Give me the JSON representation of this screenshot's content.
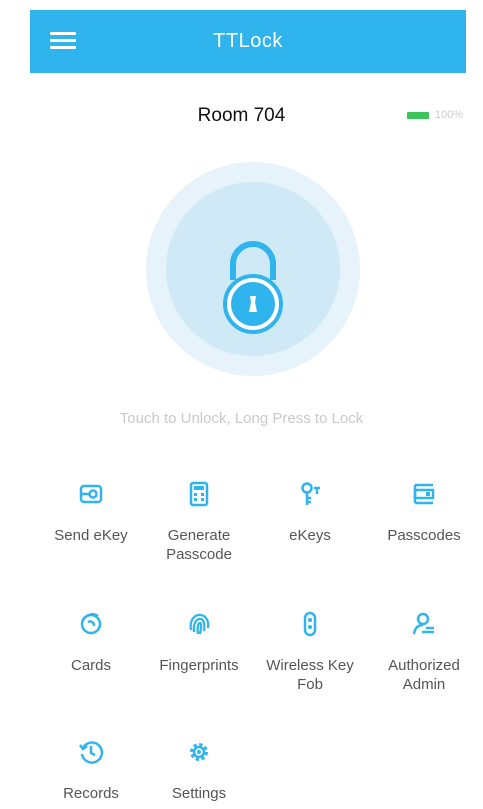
{
  "app": {
    "title": "TTLock"
  },
  "lock": {
    "room_name": "Room 704",
    "battery_percent": "100%"
  },
  "hint_text": "Touch to Unlock, Long Press to Lock",
  "menu": [
    {
      "line1": "Send eKey",
      "line2": "",
      "icon": "send-ekey-icon"
    },
    {
      "line1": "Generate",
      "line2": "Passcode",
      "icon": "calculator-icon"
    },
    {
      "line1": "eKeys",
      "line2": "",
      "icon": "key-icon"
    },
    {
      "line1": "Passcodes",
      "line2": "",
      "icon": "passcodes-icon"
    },
    {
      "line1": "Cards",
      "line2": "",
      "icon": "card-icon"
    },
    {
      "line1": "Fingerprints",
      "line2": "",
      "icon": "fingerprint-icon"
    },
    {
      "line1": "Wireless Key",
      "line2": "Fob",
      "icon": "key-fob-icon"
    },
    {
      "line1": "Authorized",
      "line2": "Admin",
      "icon": "admin-icon"
    },
    {
      "line1": "Records",
      "line2": "",
      "icon": "history-icon"
    },
    {
      "line1": "Settings",
      "line2": "",
      "icon": "gear-icon"
    }
  ],
  "colors": {
    "accent": "#2fb4ee",
    "battery": "#3bc35c",
    "hint": "#c9c9c9"
  }
}
